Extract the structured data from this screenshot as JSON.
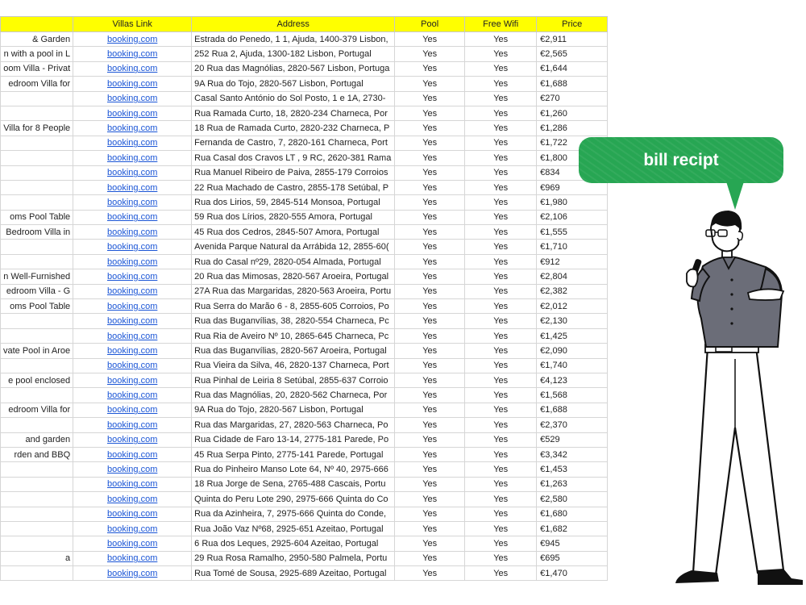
{
  "table": {
    "headers": [
      "",
      "Villas Link",
      "Address",
      "Pool",
      "Free Wifi",
      "Price"
    ],
    "rows": [
      [
        "& Garden",
        "booking.com",
        "Estrada do Penedo, 1 1, Ajuda, 1400-379 Lisbon,",
        "Yes",
        "Yes",
        "€2,911"
      ],
      [
        "n with a pool in L",
        "booking.com",
        "252 Rua 2, Ajuda, 1300-182 Lisbon, Portugal",
        "Yes",
        "Yes",
        "€2,565"
      ],
      [
        "oom Villa - Privat",
        "booking.com",
        "20 Rua das Magnólias, 2820-567 Lisbon, Portuga",
        "Yes",
        "Yes",
        "€1,644"
      ],
      [
        "edroom Villa for",
        "booking.com",
        "9A Rua do Tojo, 2820-567 Lisbon, Portugal",
        "Yes",
        "Yes",
        "€1,688"
      ],
      [
        "",
        "booking.com",
        " Casal Santo António do Sol Posto, 1 e 1A, 2730-",
        "Yes",
        "Yes",
        "€270"
      ],
      [
        "",
        "booking.com",
        "Rua Ramada Curto, 18, 2820-234 Charneca, Por",
        "Yes",
        "Yes",
        "€1,260"
      ],
      [
        "Villa for 8 People",
        "booking.com",
        "18 Rua de Ramada Curto, 2820-232 Charneca, P",
        "Yes",
        "Yes",
        "€1,286"
      ],
      [
        "",
        "booking.com",
        "Fernanda de Castro, 7, 2820-161 Charneca, Port",
        "Yes",
        "Yes",
        "€1,722"
      ],
      [
        "",
        "booking.com",
        "Rua Casal dos Cravos LT , 9 RC, 2620-381 Rama",
        "Yes",
        "Yes",
        "€1,800"
      ],
      [
        "",
        "booking.com",
        "Rua Manuel Ribeiro de Paiva, 2855-179 Corroios",
        "Yes",
        "Yes",
        "€834"
      ],
      [
        "",
        "booking.com",
        "22 Rua Machado de Castro, 2855-178 Setúbal, P",
        "Yes",
        "Yes",
        "€969"
      ],
      [
        "",
        "booking.com",
        "Rua dos Lirios, 59, 2845-514 Monsoa, Portugal",
        "Yes",
        "Yes",
        "€1,980"
      ],
      [
        "oms Pool Table",
        "booking.com",
        "59 Rua dos Lírios, 2820-555 Amora, Portugal",
        "Yes",
        "Yes",
        "€2,106"
      ],
      [
        "Bedroom Villa in",
        "booking.com",
        "45 Rua dos Cedros, 2845-507 Amora, Portugal",
        "Yes",
        "Yes",
        "€1,555"
      ],
      [
        "",
        "booking.com",
        "Avenida Parque Natural da Arrábida 12, 2855-60(",
        "Yes",
        "Yes",
        "€1,710"
      ],
      [
        "",
        "booking.com",
        "Rua do Casal nº29, 2820-054 Almada, Portugal",
        "Yes",
        "Yes",
        "€912"
      ],
      [
        "n Well-Furnished",
        "booking.com",
        "20 Rua das Mimosas, 2820-567 Aroeira, Portugal",
        "Yes",
        "Yes",
        "€2,804"
      ],
      [
        "edroom Villa - G",
        "booking.com",
        "27A Rua das Margaridas, 2820-563 Aroeira, Portu",
        "Yes",
        "Yes",
        "€2,382"
      ],
      [
        "oms Pool Table",
        "booking.com",
        "Rua Serra do Marão 6 - 8, 2855-605 Corroios, Po",
        "Yes",
        "Yes",
        "€2,012"
      ],
      [
        "",
        "booking.com",
        "Rua das Buganvílias, 38, 2820-554 Charneca, Pc",
        "Yes",
        "Yes",
        "€2,130"
      ],
      [
        "",
        "booking.com",
        "Rua Ria de Aveiro Nº 10, 2865-645 Charneca, Pc",
        "Yes",
        "Yes",
        "€1,425"
      ],
      [
        "vate Pool in Aroe",
        "booking.com",
        "Rua das Buganvílias, 2820-567 Aroeira, Portugal",
        "Yes",
        "Yes",
        "€2,090"
      ],
      [
        "",
        "booking.com",
        "Rua Vieira da Silva, 46, 2820-137 Charneca, Port",
        "Yes",
        "Yes",
        "€1,740"
      ],
      [
        "e pool enclosed",
        "booking.com",
        "Rua Pinhal de Leiria 8 Setúbal, 2855-637 Corroio",
        "Yes",
        "Yes",
        "€4,123"
      ],
      [
        "",
        "booking.com",
        "Rua das Magnólias, 20, 2820-562 Charneca, Por",
        "Yes",
        "Yes",
        "€1,568"
      ],
      [
        "edroom Villa for",
        "booking.com",
        "9A Rua do Tojo, 2820-567 Lisbon, Portugal",
        "Yes",
        "Yes",
        "€1,688"
      ],
      [
        "",
        "booking.com",
        "Rua das Margaridas, 27, 2820-563 Charneca, Po",
        "Yes",
        "Yes",
        "€2,370"
      ],
      [
        "and garden",
        "booking.com",
        "Rua Cidade de Faro 13-14, 2775-181 Parede, Po",
        "Yes",
        "Yes",
        "€529"
      ],
      [
        "rden and BBQ",
        "booking.com",
        "45 Rua Serpa Pinto, 2775-141 Parede, Portugal",
        "Yes",
        "Yes",
        "€3,342"
      ],
      [
        "",
        "booking.com",
        "Rua do Pinheiro Manso Lote 64, Nº 40, 2975-666",
        "Yes",
        "Yes",
        "€1,453"
      ],
      [
        "",
        "booking.com",
        "18 Rua Jorge de Sena, 2765-488 Cascais, Portu",
        "Yes",
        "Yes",
        "€1,263"
      ],
      [
        "",
        "booking.com",
        "Quinta do Peru Lote 290, 2975-666 Quinta do Co",
        "Yes",
        "Yes",
        "€2,580"
      ],
      [
        "",
        "booking.com",
        "Rua da Azinheira, 7, 2975-666 Quinta do Conde,",
        "Yes",
        "Yes",
        "€1,680"
      ],
      [
        "",
        "booking.com",
        "Rua João Vaz Nº68, 2925-651 Azeitao, Portugal",
        "Yes",
        "Yes",
        "€1,682"
      ],
      [
        "",
        "booking.com",
        "6 Rua dos Leques, 2925-604 Azeitao, Portugal",
        "Yes",
        "Yes",
        "€945"
      ],
      [
        "a",
        "booking.com",
        "29 Rua Rosa Ramalho, 2950-580 Palmela, Portu",
        "Yes",
        "Yes",
        "€695"
      ],
      [
        "",
        "booking.com",
        "Rua Tomé de Sousa, 2925-689 Azeitao, Portugal",
        "Yes",
        "Yes",
        "€1,470"
      ]
    ]
  },
  "bubble": {
    "text": "bill recipt"
  },
  "colors": {
    "header_bg": "#ffff00",
    "link": "#1a55d6",
    "bubble": "#27a653",
    "shirt": "#6b6d78"
  },
  "icons": {
    "person": "person-with-microphone-illustration"
  }
}
